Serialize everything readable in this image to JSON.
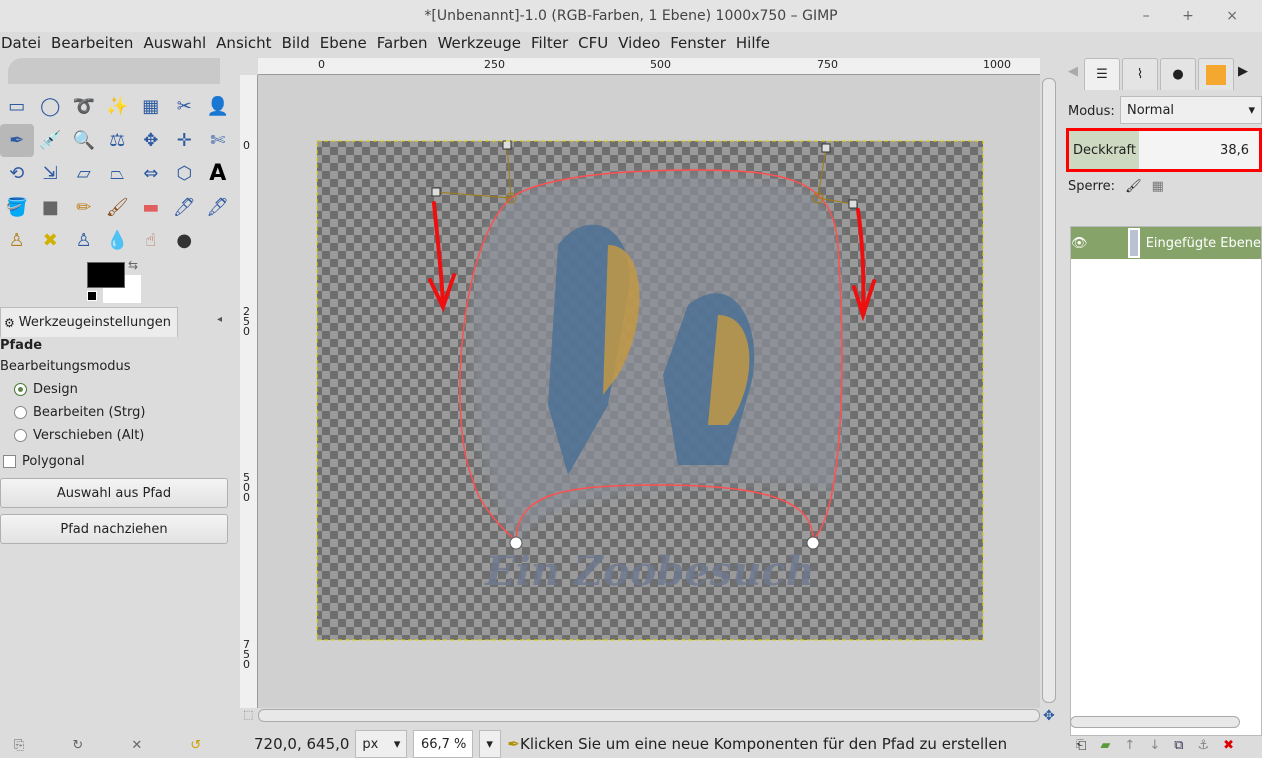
{
  "window": {
    "title": "*[Unbenannt]-1.0 (RGB-Farben, 1 Ebene) 1000x750 – GIMP",
    "controls": "– + ×"
  },
  "menu": [
    "Datei",
    "Bearbeiten",
    "Auswahl",
    "Ansicht",
    "Bild",
    "Ebene",
    "Farben",
    "Werkzeuge",
    "Filter",
    "CFU",
    "Video",
    "Fenster",
    "Hilfe"
  ],
  "tool_options": {
    "tab_label": "Werkzeugeinstellungen",
    "title": "Pfade",
    "mode_label": "Bearbeitungsmodus",
    "modes": [
      {
        "label": "Design",
        "selected": true
      },
      {
        "label": "Bearbeiten (Strg)",
        "selected": false
      },
      {
        "label": "Verschieben (Alt)",
        "selected": false
      }
    ],
    "polygonal_label": "Polygonal",
    "polygonal_checked": false,
    "buttons": [
      "Auswahl aus Pfad",
      "Pfad nachziehen"
    ]
  },
  "ruler": {
    "top": [
      "0",
      "250",
      "500",
      "750",
      "1000"
    ],
    "left": [
      "0",
      "250",
      "500",
      "750"
    ]
  },
  "canvas": {
    "image_text": "Ein Zoobesuch"
  },
  "status": {
    "coords": "720,0, 645,0",
    "unit": "px",
    "zoom": "66,7 %",
    "message": "Klicken Sie um eine neue Komponenten für den Pfad zu erstellen"
  },
  "layers": {
    "mode_label": "Modus:",
    "mode_value": "Normal",
    "opacity_label": "Deckkraft",
    "opacity_value": "38,6",
    "lock_label": "Sperre:",
    "items": [
      {
        "name": "Eingefügte Ebene",
        "visible": true
      }
    ]
  },
  "colors": {
    "highlight": "#ff0000",
    "layer_selected": "#86a46a",
    "path": "#ff5050"
  }
}
